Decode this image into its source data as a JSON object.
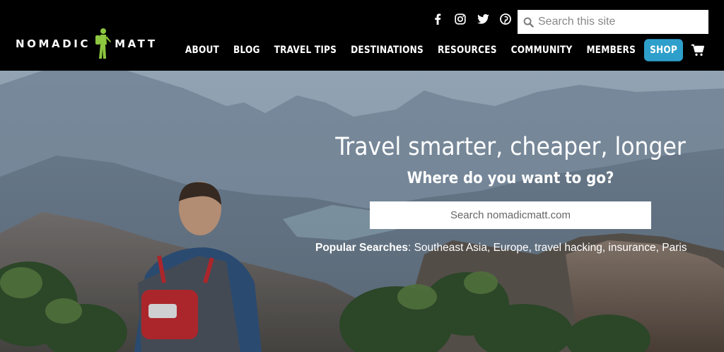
{
  "brand": {
    "left": "NOMADIC",
    "right": "MATT",
    "figure_color": "#8dc63f"
  },
  "social": [
    {
      "name": "facebook-icon"
    },
    {
      "name": "instagram-icon"
    },
    {
      "name": "twitter-icon"
    },
    {
      "name": "pinterest-icon"
    }
  ],
  "site_search": {
    "placeholder": "Search this site"
  },
  "nav": {
    "items": [
      "ABOUT",
      "BLOG",
      "TRAVEL TIPS",
      "DESTINATIONS",
      "RESOURCES",
      "COMMUNITY",
      "MEMBERS"
    ],
    "shop": "SHOP",
    "shop_color": "#2e9fcb"
  },
  "hero": {
    "title": "Travel smarter, cheaper, longer",
    "subtitle": "Where do you want to go?",
    "search_placeholder": "Search nomadicmatt.com",
    "popular_label": "Popular Searches",
    "popular_terms": ": Southeast Asia, Europe, travel hacking, insurance, Paris"
  }
}
